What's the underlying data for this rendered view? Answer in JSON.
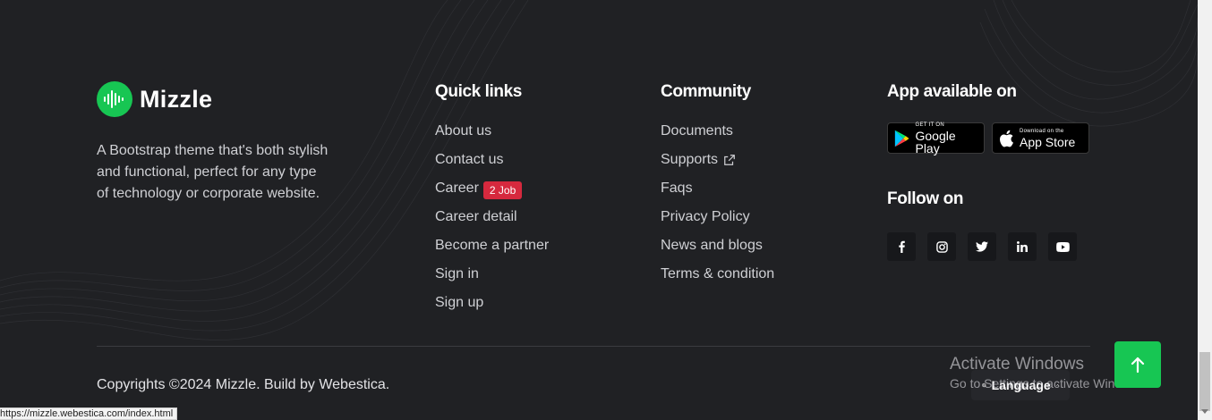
{
  "brand": {
    "name": "Mizzle",
    "description": "A Bootstrap theme that's both stylish and functional, perfect for any type of technology or corporate website."
  },
  "quick_links": {
    "title": "Quick links",
    "items": [
      {
        "label": "About us"
      },
      {
        "label": "Contact us"
      },
      {
        "label": "Career",
        "badge": "2 Job"
      },
      {
        "label": "Career detail"
      },
      {
        "label": "Become a partner"
      },
      {
        "label": "Sign in"
      },
      {
        "label": "Sign up"
      }
    ]
  },
  "community": {
    "title": "Community",
    "items": [
      {
        "label": "Documents"
      },
      {
        "label": "Supports",
        "icon": "external-link-icon"
      },
      {
        "label": "Faqs"
      },
      {
        "label": "Privacy Policy"
      },
      {
        "label": "News and blogs"
      },
      {
        "label": "Terms & condition"
      }
    ]
  },
  "app": {
    "title": "App available on",
    "google_play": {
      "small": "GET IT ON",
      "big": "Google Play"
    },
    "app_store": {
      "small": "Download on the",
      "big": "App Store"
    }
  },
  "follow": {
    "title": "Follow on",
    "icons": [
      "facebook-icon",
      "instagram-icon",
      "twitter-icon",
      "linkedin-icon",
      "youtube-icon"
    ]
  },
  "copyright": "Copyrights ©2024 Mizzle. Build by Webestica.",
  "language": {
    "label": "Language"
  },
  "activate_windows": {
    "line1": "Activate Windows",
    "line2": "Go to Settings to activate Windows."
  },
  "status_url": "https://mizzle.webestica.com/index.html",
  "colors": {
    "background": "#202124",
    "accent": "#17c653",
    "badge": "#d6293e"
  }
}
